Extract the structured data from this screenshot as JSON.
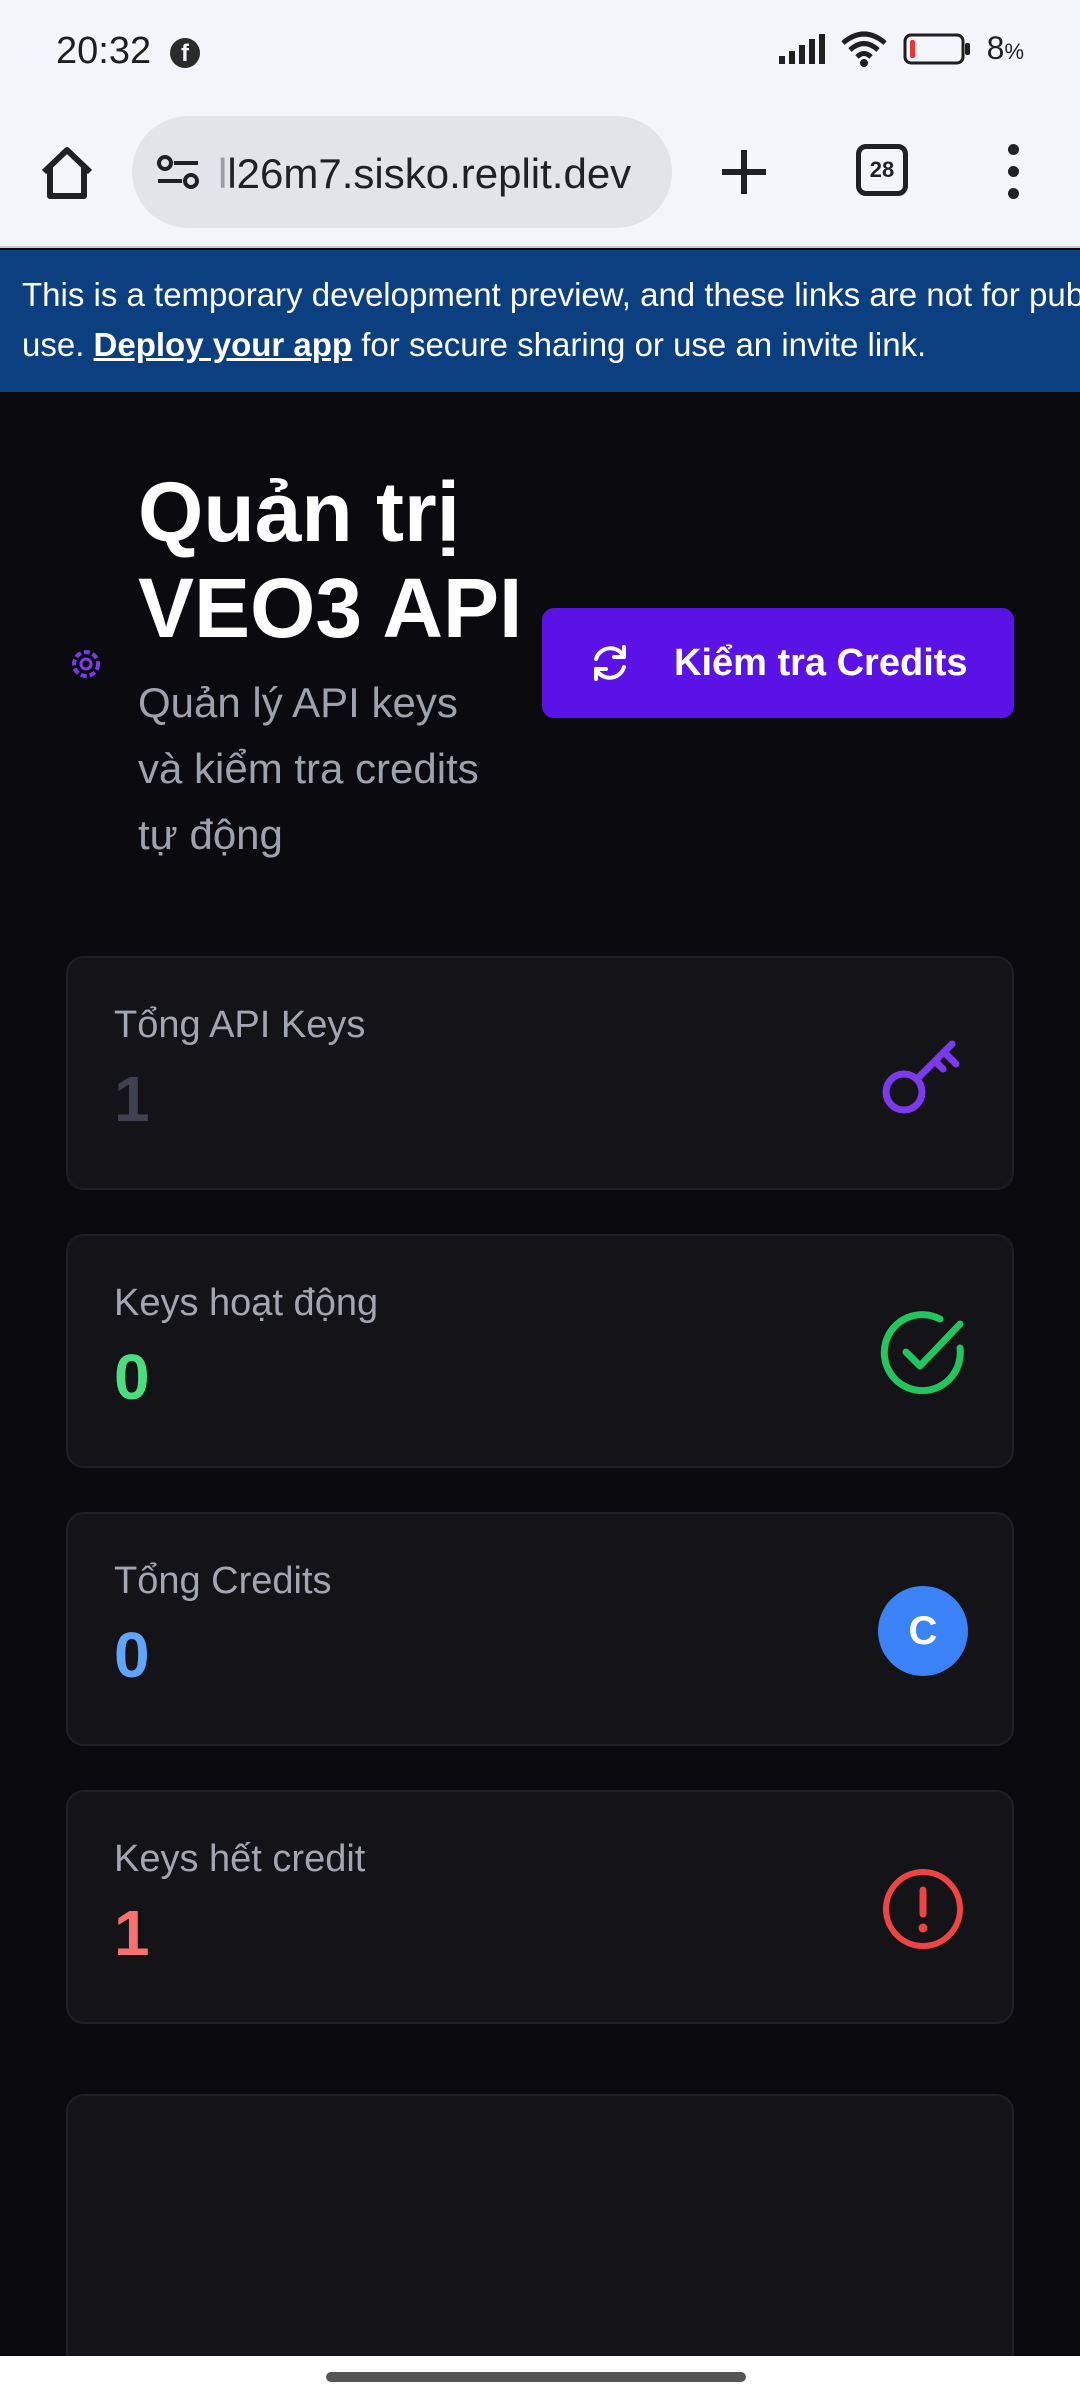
{
  "status_bar": {
    "time": "20:32",
    "battery": "8",
    "battery_unit": "%"
  },
  "browser": {
    "url_faded": "l",
    "url_main": "l26m7.sisko.replit.dev",
    "tab_count": "28",
    "icons": [
      "home-icon",
      "tune-icon",
      "plus-icon",
      "tabs-icon",
      "more-vert-icon"
    ]
  },
  "banner": {
    "line1": "This is a temporary development preview, and these links are not for pub",
    "line2_prefix": "use.",
    "link_text": "Deploy your app",
    "line2_suffix": "for secure sharing or use an invite link."
  },
  "header": {
    "title_line1": "Quản trị",
    "title_line2": "VEO3 API",
    "subtitle_line1": "Quản lý API keys",
    "subtitle_line2": "và kiểm tra credits",
    "subtitle_line3": "tự động",
    "check_button_label": "Kiểm tra Credits"
  },
  "stats": [
    {
      "label": "Tổng API Keys",
      "value": "1",
      "color": "#3f4150",
      "icon": "key-icon"
    },
    {
      "label": "Keys hoạt động",
      "value": "0",
      "color": "#4ade80",
      "icon": "check-circle-icon"
    },
    {
      "label": "Tổng Credits",
      "value": "0",
      "color": "#60a5fa",
      "icon": "credits-icon",
      "icon_letter": "C"
    },
    {
      "label": "Keys hết credit",
      "value": "1",
      "color": "#f87171",
      "icon": "alert-circle-icon"
    }
  ],
  "colors": {
    "accent": "#5b12e6",
    "banner_bg": "#0c3f80",
    "app_bg": "#0b0b0f",
    "card_bg": "#131318"
  }
}
